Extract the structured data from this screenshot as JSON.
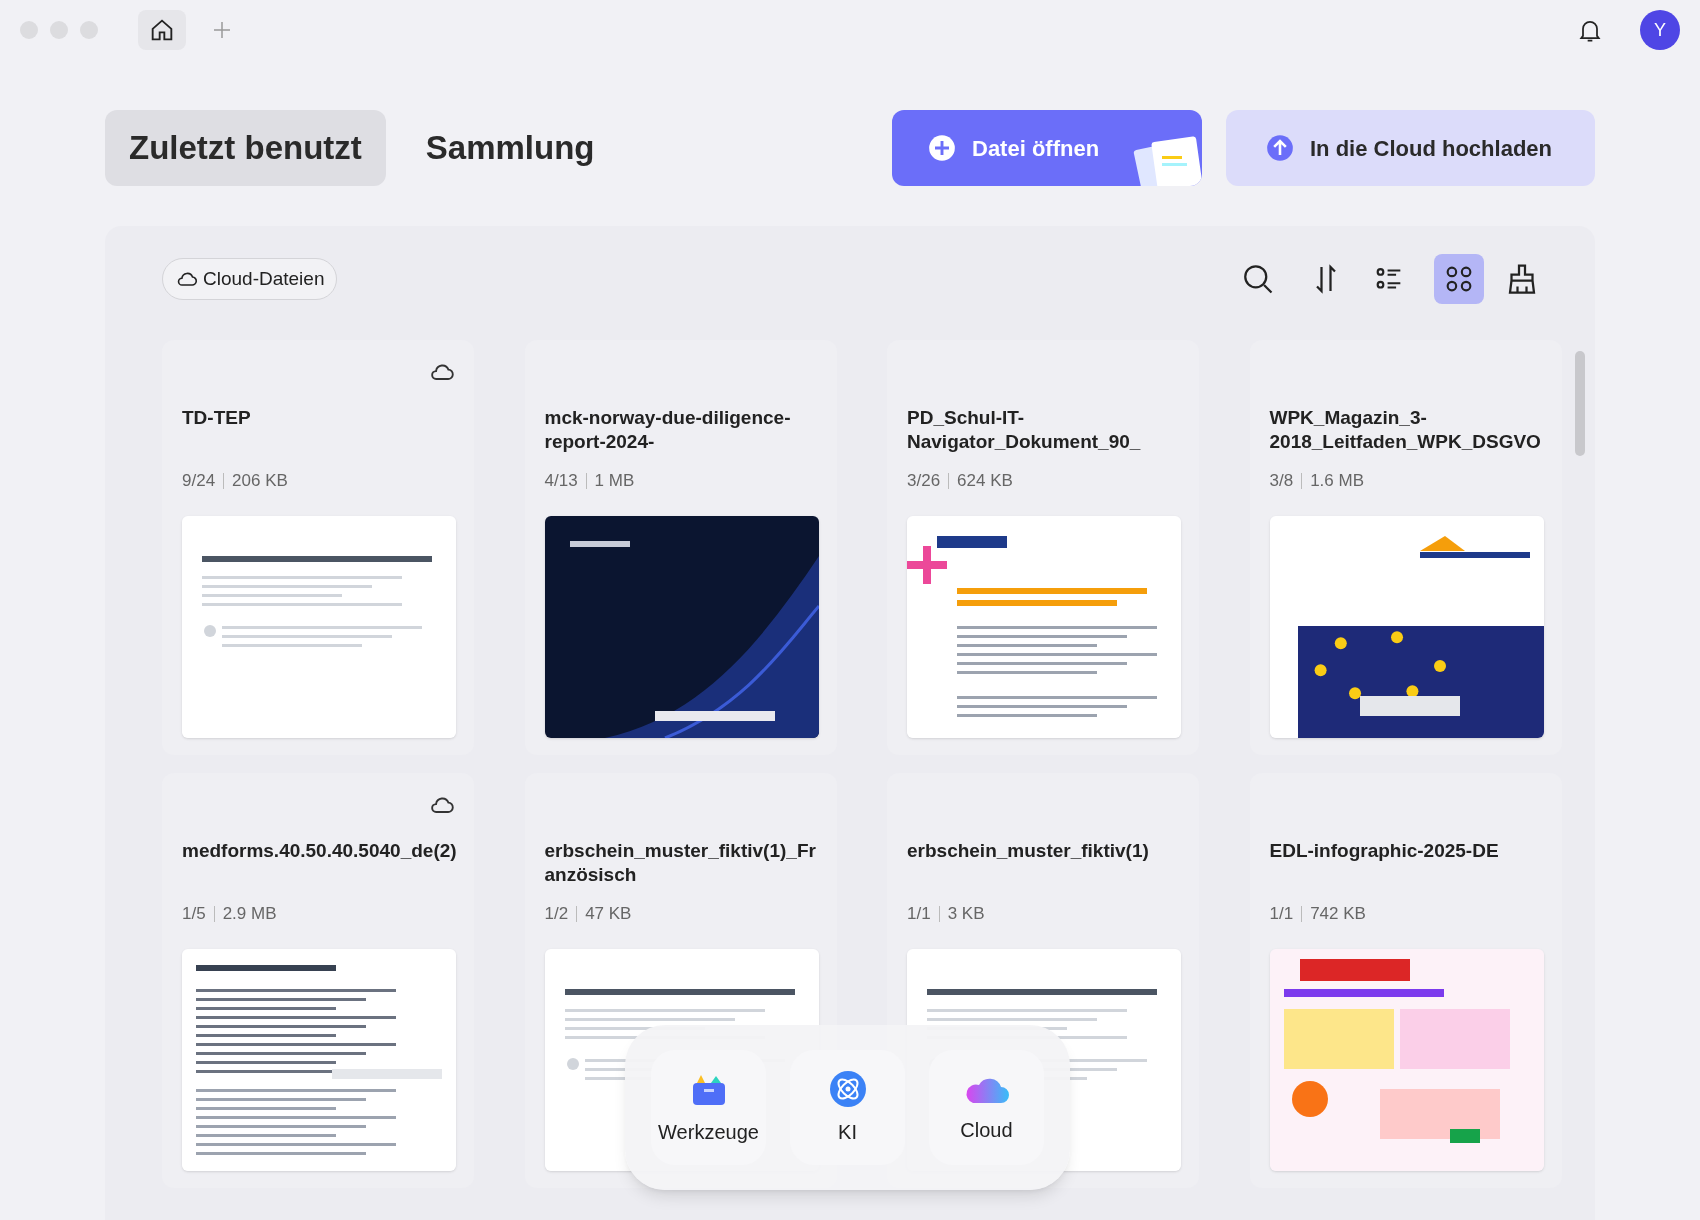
{
  "titlebar": {
    "avatar": "Y"
  },
  "tabs": [
    {
      "label": "Zuletzt benutzt",
      "selected": true
    },
    {
      "label": "Sammlung",
      "selected": false
    }
  ],
  "actions": [
    {
      "kind": "primary",
      "label": "Datei öffnen"
    },
    {
      "kind": "secondary",
      "label": "In die Cloud hochladen"
    }
  ],
  "filter": {
    "label": "Cloud-Dateien"
  },
  "view_mode": {
    "grid_selected": true
  },
  "files": [
    {
      "name": "TD-TEP",
      "pages": "9/24",
      "size": "206 KB",
      "cloud": true
    },
    {
      "name": "mck-norway-due-diligence-report-2024-",
      "pages": "4/13",
      "size": "1 MB",
      "cloud": false
    },
    {
      "name": "PD_Schul-IT-Navigator_Dokument_90_",
      "pages": "3/26",
      "size": "624 KB",
      "cloud": false
    },
    {
      "name": "WPK_Magazin_3-2018_Leitfaden_WPK_DSGVO",
      "pages": "3/8",
      "size": "1.6 MB",
      "cloud": false
    },
    {
      "name": "medforms.40.50.40.5040_de(2)",
      "pages": "1/5",
      "size": "2.9 MB",
      "cloud": true
    },
    {
      "name": "erbschein_muster_fiktiv(1)_Französisch",
      "pages": "1/2",
      "size": "47 KB",
      "cloud": false
    },
    {
      "name": "erbschein_muster_fiktiv(1)",
      "pages": "1/1",
      "size": "3 KB",
      "cloud": false
    },
    {
      "name": "EDL-infographic-2025-DE",
      "pages": "1/1",
      "size": "742 KB",
      "cloud": false
    }
  ],
  "dock": [
    {
      "kind": "tools",
      "label": "Werkzeuge"
    },
    {
      "kind": "ai",
      "label": "KI"
    },
    {
      "kind": "cloud",
      "label": "Cloud"
    }
  ]
}
